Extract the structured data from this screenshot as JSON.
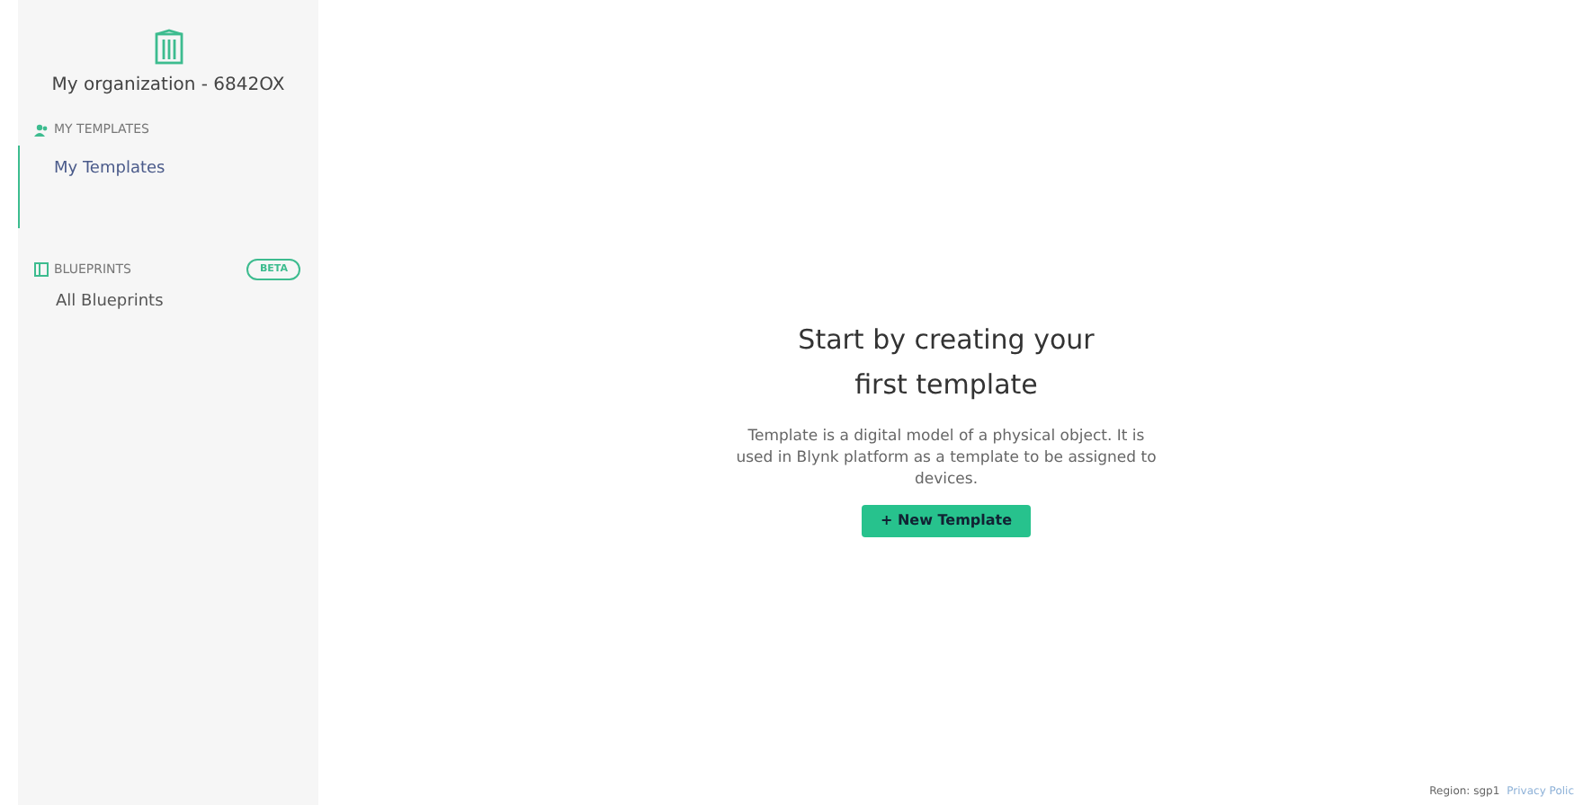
{
  "organization": {
    "name": "My organization - 6842OX"
  },
  "sidebar": {
    "sections": [
      {
        "kind": "templates",
        "title": "MY TEMPLATES",
        "items": [
          {
            "label": "My Templates",
            "selected": true
          }
        ]
      },
      {
        "kind": "blueprints",
        "title": "BLUEPRINTS",
        "badge": "BETA",
        "items": [
          {
            "label": "All Blueprints",
            "selected": false
          }
        ]
      }
    ]
  },
  "empty_state": {
    "title": "Start by creating your first template",
    "description": "Template is a digital model of a physical object. It is used in Blynk platform as a template to be assigned to devices.",
    "button": "+ New Template"
  },
  "footer": {
    "region": "Region: sgp1",
    "link": "Privacy Polic"
  }
}
